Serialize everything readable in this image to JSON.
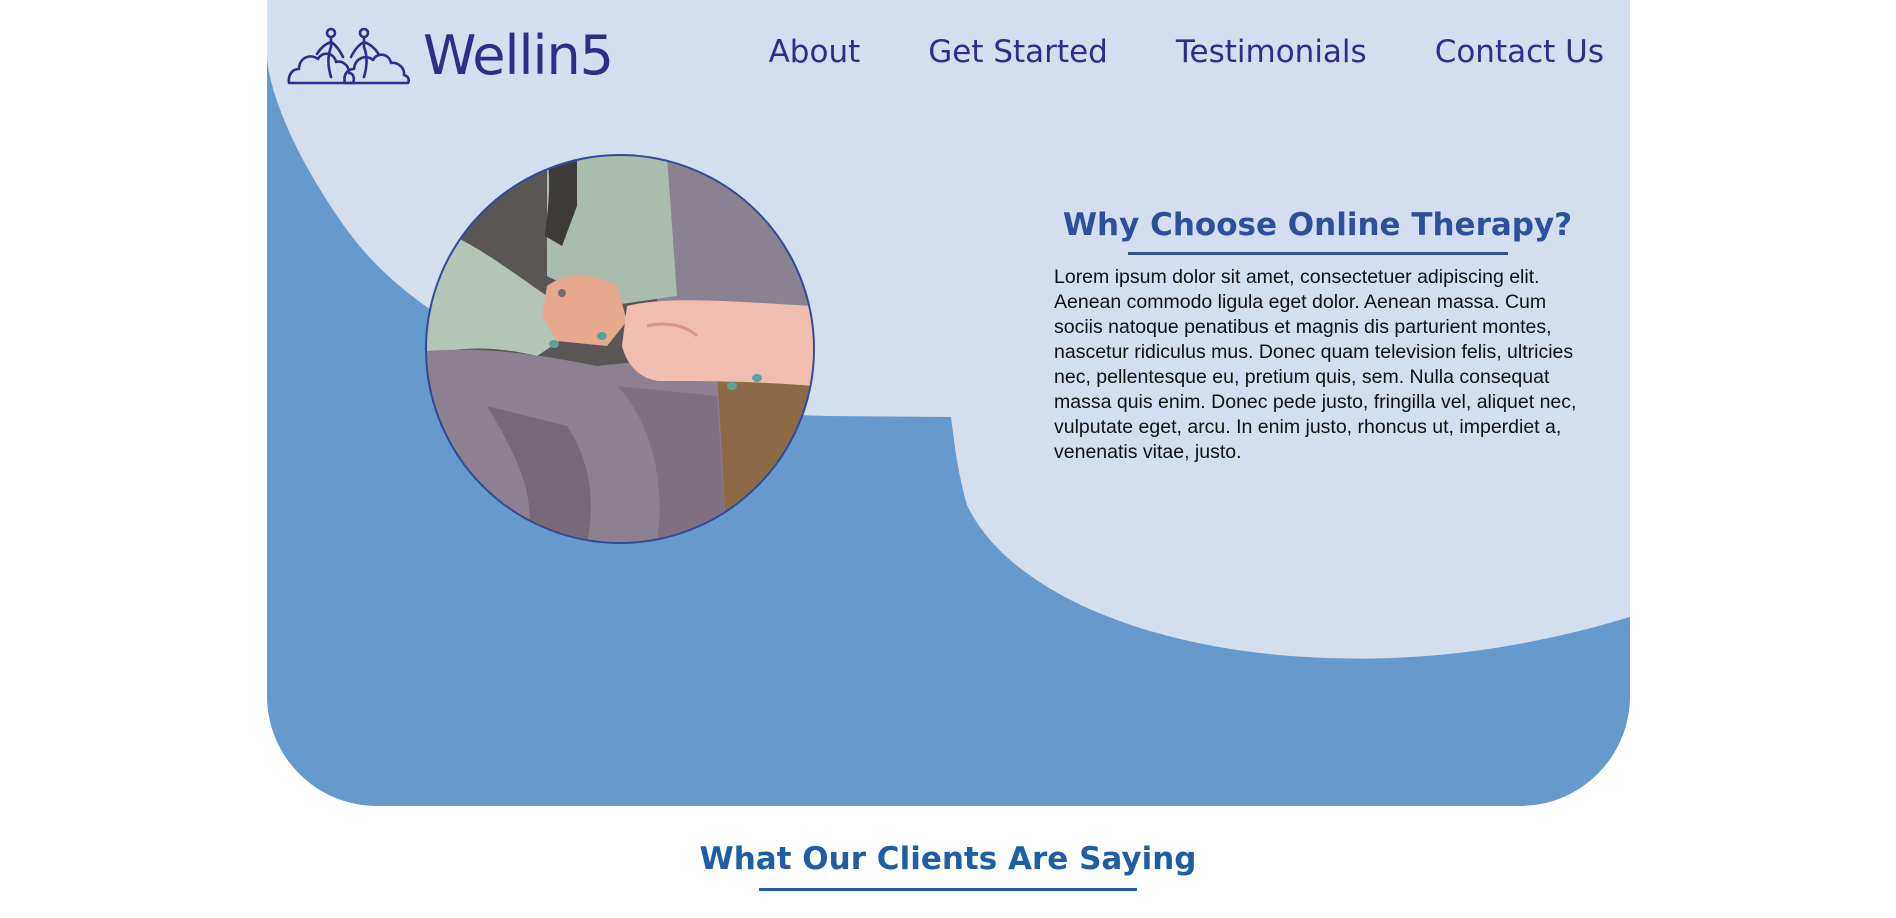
{
  "brand": {
    "name": "Wellin5",
    "logo_icon": "two-people-on-clouds-icon",
    "color": "#2e2e8a"
  },
  "nav": {
    "items": [
      {
        "label": "About"
      },
      {
        "label": "Get Started"
      },
      {
        "label": "Testimonials"
      },
      {
        "label": "Contact Us"
      }
    ]
  },
  "hero": {
    "image_subject": "two people holding hands",
    "why_title": "Why Choose Online Therapy?",
    "why_body": "Lorem ipsum dolor sit amet, consectetuer adipiscing elit. Aenean commodo ligula eget dolor. Aenean massa. Cum sociis natoque penatibus et magnis dis parturient montes, nascetur ridiculus mus. Donec quam television felis, ultricies nec, pellentesque eu, pretium quis, sem. Nulla consequat massa quis enim. Donec pede justo, fringilla vel, aliquet nec, vulputate eget, arcu. In enim justo, rhoncus ut, imperdiet a, venenatis vitae, justo."
  },
  "testimonials": {
    "title": "What Our Clients Are Saying"
  },
  "colors": {
    "light_blue": "#d3deee",
    "mid_blue": "#6699cc",
    "navy": "#2e2e8a",
    "heading_blue": "#2e4f9c",
    "section_blue": "#1e5ea3"
  }
}
